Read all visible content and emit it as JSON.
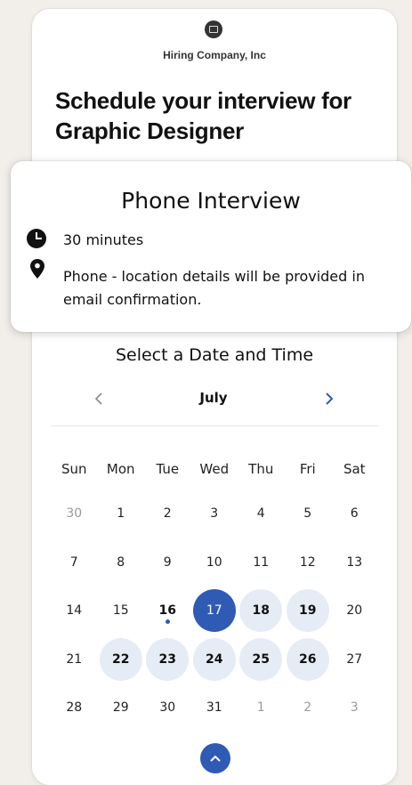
{
  "company": {
    "name": "Hiring Company, Inc",
    "logo_icon": "building-icon"
  },
  "heading": "Schedule your interview for Graphic Designer",
  "event": {
    "title": "Phone Interview",
    "duration": "30 minutes",
    "location": "Phone - location details will be provided in email confirmation."
  },
  "calendar": {
    "title": "Select a Date and Time",
    "month": "July",
    "weekdays": [
      "Sun",
      "Mon",
      "Tue",
      "Wed",
      "Thu",
      "Fri",
      "Sat"
    ],
    "weeks": [
      [
        {
          "d": "30",
          "s": "muted"
        },
        {
          "d": "1"
        },
        {
          "d": "2"
        },
        {
          "d": "3"
        },
        {
          "d": "4"
        },
        {
          "d": "5"
        },
        {
          "d": "6"
        }
      ],
      [
        {
          "d": "7"
        },
        {
          "d": "8"
        },
        {
          "d": "9"
        },
        {
          "d": "10"
        },
        {
          "d": "11"
        },
        {
          "d": "12"
        },
        {
          "d": "13"
        }
      ],
      [
        {
          "d": "14"
        },
        {
          "d": "15"
        },
        {
          "d": "16",
          "s": "today"
        },
        {
          "d": "17",
          "s": "selected"
        },
        {
          "d": "18",
          "s": "available"
        },
        {
          "d": "19",
          "s": "available"
        },
        {
          "d": "20"
        }
      ],
      [
        {
          "d": "21"
        },
        {
          "d": "22",
          "s": "available"
        },
        {
          "d": "23",
          "s": "available"
        },
        {
          "d": "24",
          "s": "available"
        },
        {
          "d": "25",
          "s": "available"
        },
        {
          "d": "26",
          "s": "available"
        },
        {
          "d": "27"
        }
      ],
      [
        {
          "d": "28"
        },
        {
          "d": "29"
        },
        {
          "d": "30"
        },
        {
          "d": "31"
        },
        {
          "d": "1",
          "s": "muted"
        },
        {
          "d": "2",
          "s": "muted"
        },
        {
          "d": "3",
          "s": "muted"
        }
      ]
    ]
  },
  "colors": {
    "accent": "#2f5bb5",
    "available": "#e6ecf6",
    "background": "#f2efea"
  }
}
